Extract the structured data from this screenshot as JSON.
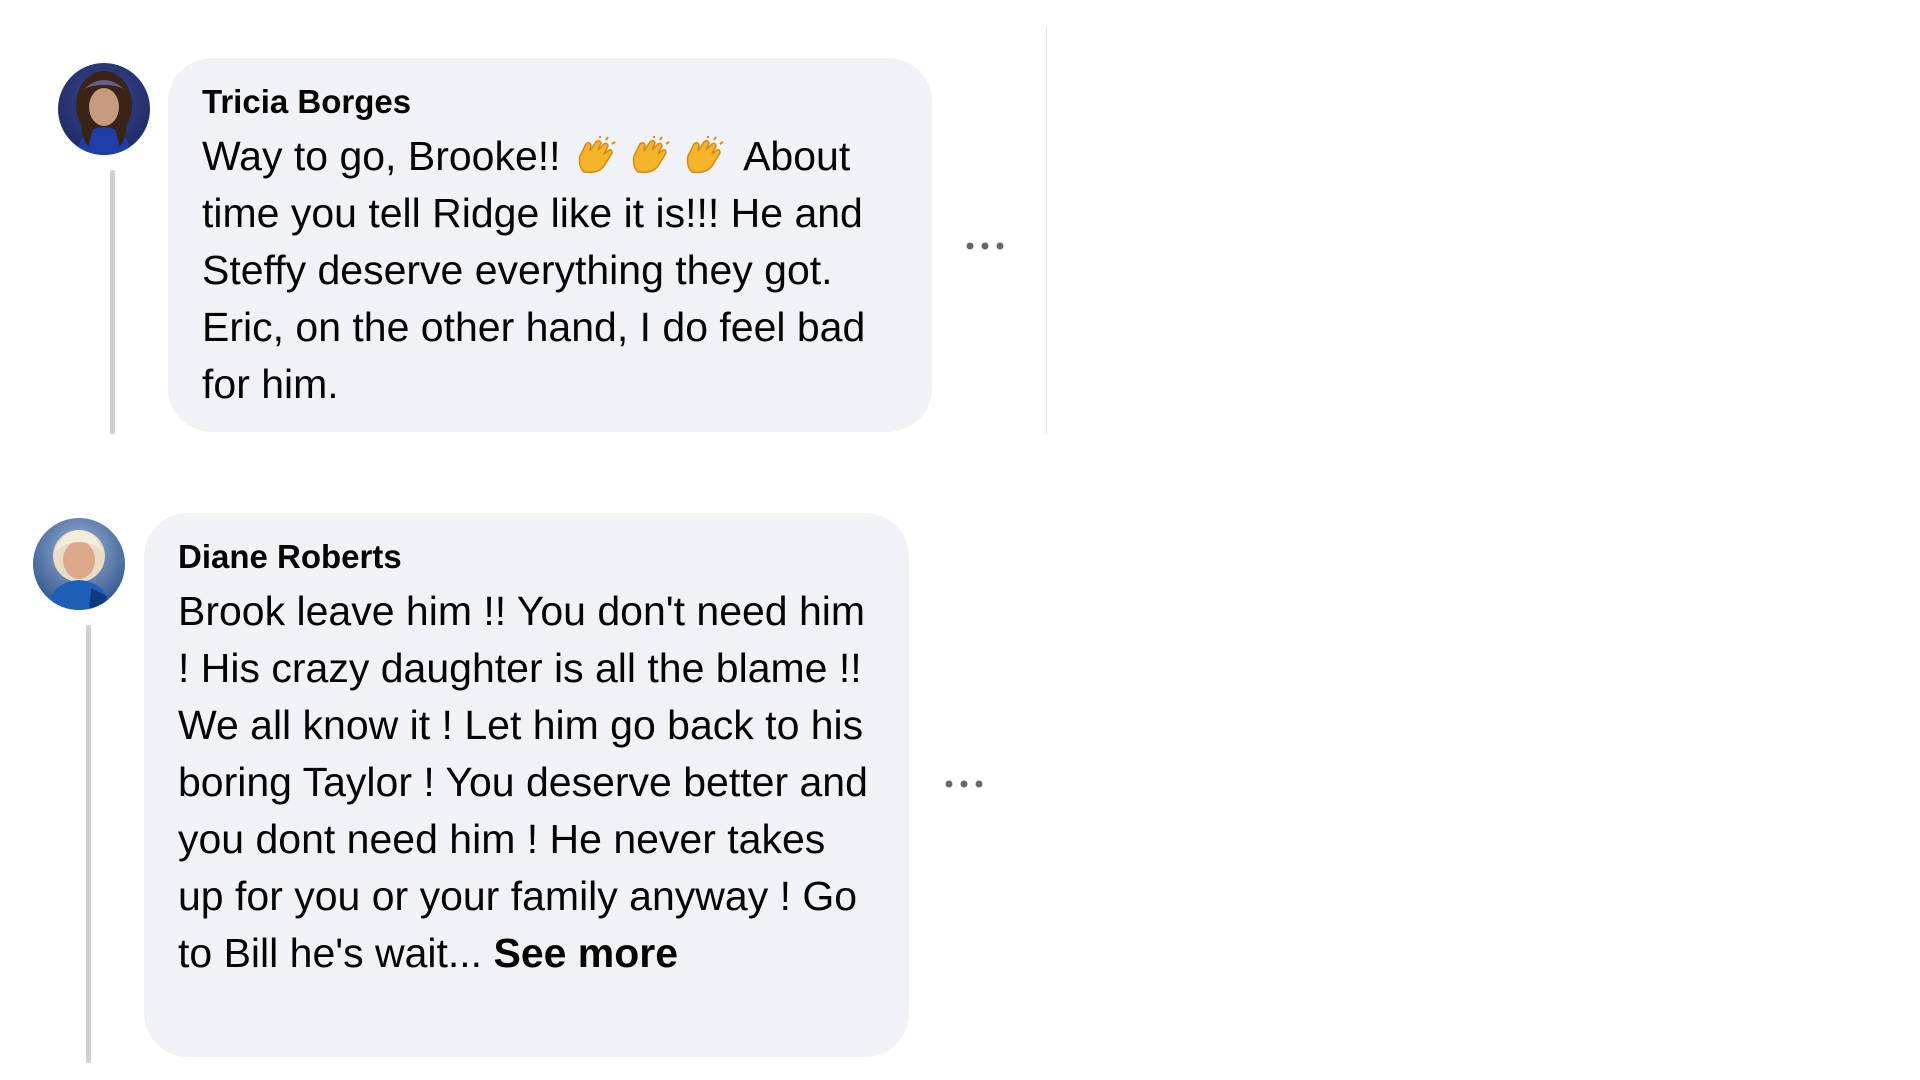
{
  "comments": [
    {
      "author": "Tricia Borges",
      "text_before": "Way to go, Brooke!!",
      "emoji": [
        "clapping-hands",
        "clapping-hands",
        "clapping-hands"
      ],
      "text_after": "About time you tell Ridge like it is!!! He and Steffy deserve everything they got. Eric, on the other hand, I do feel bad for him."
    },
    {
      "author": "Diane Roberts",
      "text": "Brook leave him !! You don't need him ! His crazy daughter is all the blame !! We all know it ! Let him go back to his boring Taylor ! You deserve better and you dont need him ! He never takes up for you or your family anyway ! Go to Bill he's wait...",
      "see_more": "See more"
    }
  ],
  "icons": {
    "more_actions": "more-horizontal-icon"
  },
  "colors": {
    "bubble_bg": "#f0f2f5",
    "thread_line": "#ced0d4",
    "muted_icon": "#65676b"
  }
}
